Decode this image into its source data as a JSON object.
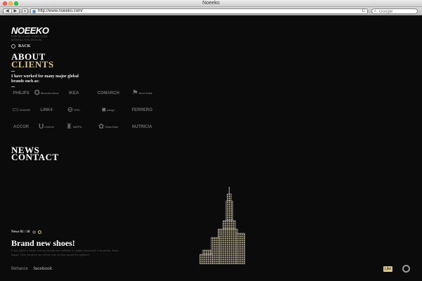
{
  "window": {
    "title": "Noeeko"
  },
  "toolbar": {
    "back": "◀",
    "forward": "▶",
    "add": "+",
    "url": "http://www.noeeko.com/",
    "reload": "C",
    "search_placeholder": "Google"
  },
  "site": {
    "logo": "NOEEKO",
    "tagline": "Digital & Art Direction Interactive Design",
    "back_label": "BACK",
    "nav": {
      "about": "ABOUT",
      "clients": "CLIENTS",
      "news": "NEWS",
      "contact": "CONTACT"
    },
    "intro": "I have worked for many major global brands such as:",
    "brands": [
      {
        "name": "PHILIPS"
      },
      {
        "name": "Mercedes-Benz",
        "glyph": "✪"
      },
      {
        "name": "IKEA"
      },
      {
        "name": "COMARCH"
      },
      {
        "name": "Reed Zelda",
        "glyph": "⚑"
      },
      {
        "name": "ORANGE",
        "glyph": "▭"
      },
      {
        "name": "LINK4"
      },
      {
        "name": "OPEL",
        "glyph": "⊖"
      },
      {
        "name": "orange",
        "glyph": "■"
      },
      {
        "name": "FERRERO"
      },
      {
        "name": "ACCOR"
      },
      {
        "name": "Unilever",
        "glyph": "U"
      },
      {
        "name": "WARTA",
        "glyph": "♜"
      },
      {
        "name": "Gadu-Gadu",
        "glyph": "✿"
      },
      {
        "name": "NUTRICIA"
      }
    ],
    "news": {
      "counter": "News 01 / 10",
      "title": "Brand new shoes!",
      "text": "It has taken a while, but my brand new website is finally launched! I am pretty damn happy. New projects are on the way so stay tuned for updates!"
    },
    "social": {
      "behance": "Behance",
      "facebook": "facebook"
    },
    "like_label": "Like"
  },
  "colors": {
    "accent": "#d7c48a",
    "background": "#0b0b0b"
  }
}
